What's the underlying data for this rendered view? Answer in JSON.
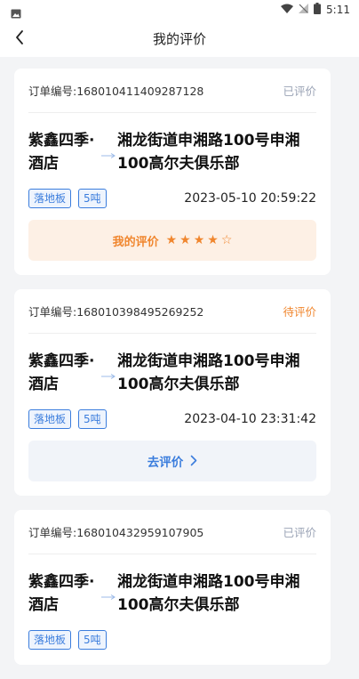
{
  "status_bar": {
    "time": "5:11"
  },
  "header": {
    "title": "我的评价"
  },
  "orders": [
    {
      "order_label": "订单编号:168010411409287128",
      "status": "已评价",
      "from": "紫鑫四季·酒店",
      "to": "湘龙街道申湘路100号申湘100高尔夫俱乐部",
      "tags": [
        "落地板",
        "5吨"
      ],
      "time": "2023-05-10 20:59:22",
      "action_label": "我的评价",
      "rating": 4,
      "max_rating": 5
    },
    {
      "order_label": "订单编号:168010398495269252",
      "status": "待评价",
      "from": "紫鑫四季·酒店",
      "to": "湘龙街道申湘路100号申湘100高尔夫俱乐部",
      "tags": [
        "落地板",
        "5吨"
      ],
      "time": "2023-04-10 23:31:42",
      "action_label": "去评价"
    },
    {
      "order_label": "订单编号:168010432959107905",
      "status": "已评价",
      "from": "紫鑫四季·酒店",
      "to": "湘龙街道申湘路100号申湘100高尔夫俱乐部",
      "tags": [
        "落地板",
        "5吨"
      ]
    }
  ],
  "colors": {
    "accent_blue": "#3b7ddd",
    "accent_orange": "#f0862e",
    "muted": "#9aa3b5"
  }
}
